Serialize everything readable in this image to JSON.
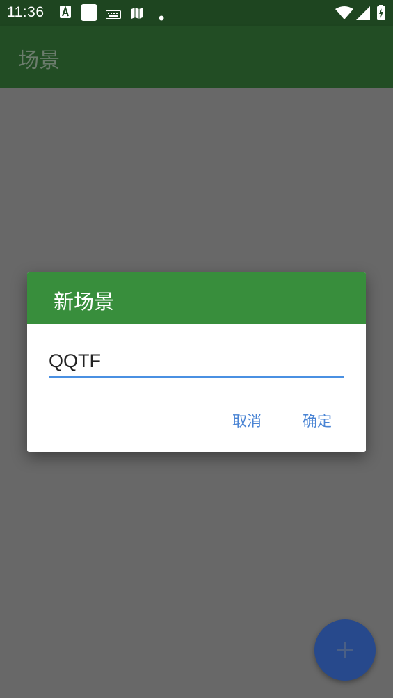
{
  "status_bar": {
    "time": "11:36",
    "icons": [
      "font-a-icon",
      "white-square-icon",
      "keyboard-icon",
      "map-icon",
      "dot-icon",
      "wifi-icon",
      "signal-icon",
      "battery-charging-icon"
    ]
  },
  "app_bar": {
    "title": "场景"
  },
  "dialog": {
    "title": "新场景",
    "input_value": "QQTF",
    "cancel_label": "取消",
    "confirm_label": "确定"
  },
  "fab": {
    "icon": "plus-icon"
  },
  "colors": {
    "primary_dark": "#1e4520",
    "primary": "#388e3c",
    "scrim": "#686868",
    "accent": "#4a84d4",
    "fab": "#27498c"
  }
}
